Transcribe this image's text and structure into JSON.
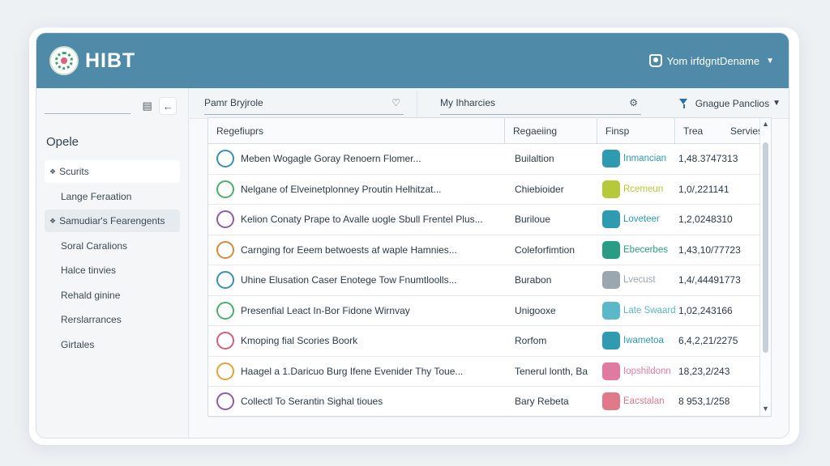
{
  "app": {
    "brand": "HIBT",
    "user": "Yom irfdgntDename"
  },
  "sidebar": {
    "title": "Opele",
    "items": [
      {
        "label": "Scurits",
        "selected": true
      },
      {
        "label": "Lange Feraation",
        "selected": false
      },
      {
        "label": "Samudiar's Fearengents",
        "selected": true
      },
      {
        "label": "Soral Caralions",
        "selected": false
      },
      {
        "label": "Halce tinvies",
        "selected": false
      },
      {
        "label": "Rehald ginine",
        "selected": false
      },
      {
        "label": "Rerslarrances",
        "selected": false
      },
      {
        "label": "Girtales",
        "selected": false
      }
    ]
  },
  "toolbar": {
    "field1": "Pamr Bryjrole",
    "field2": "My Ihharcies",
    "filter": "Gnague Panclios"
  },
  "table": {
    "columns": [
      "Regefiuprs",
      "Regaeiing",
      "Finsp",
      "Trea",
      "Servies"
    ],
    "rows": [
      {
        "title": "Meben Wogagle Goray Renoern Flomer...",
        "region": "Builaltion",
        "group": "Inmancian",
        "value": "1,48.3747313",
        "avatar": "#3b8fb0",
        "gcolor": "#2f9bb0"
      },
      {
        "title": "Nelgane of Elveinetplonney Proutin Helhitzat...",
        "region": "Chiebioider",
        "group": "Rcemeun",
        "value": "1,0/,221141",
        "avatar": "#4caf6a",
        "gcolor": "#b6c93a"
      },
      {
        "title": "Kelion Conaty Prape to Avalle uogle Sbull Frentel Plus...",
        "region": "Buriloue",
        "group": "Loveteer",
        "value": "1,2,0248310",
        "avatar": "#8f5aa8",
        "gcolor": "#2f9bb0"
      },
      {
        "title": "Carnging for Eeem betwoests af waple Hamnies...",
        "region": "Coleforfimtion",
        "group": "Ebecerbes",
        "value": "1,43,10/77723",
        "avatar": "#d38a3a",
        "gcolor": "#2a9c86"
      },
      {
        "title": "Uhine Elusation Caser Enotege Tow Fnumtloolls...",
        "region": "Burabon",
        "group": "Lvecust",
        "value": "1,4/,44491773",
        "avatar": "#3b8fb0",
        "gcolor": "#9aa6b0"
      },
      {
        "title": "Presenfial Leact In-Bor Fidone Wirnvay",
        "region": "Unigooxe",
        "group": "Late Swaard",
        "value": "1,02,243166",
        "avatar": "#4caf6a",
        "gcolor": "#5cb8c8"
      },
      {
        "title": "Kmoping fial Scories Boork",
        "region": "Rorfom",
        "group": "Iwametoa",
        "value": "6,4,2,21/2275",
        "avatar": "#d35f7a",
        "gcolor": "#2f9bb0"
      },
      {
        "title": "Haagel a 1.Daricuo Burg Ifene Evenider Thy Toue...",
        "region": "Tenerul lonth, Ba",
        "group": "Iopshildonn",
        "value": "18,23,2/243",
        "avatar": "#e0a53a",
        "gcolor": "#e07aa0"
      },
      {
        "title": "Collectl To Serantin Sighal tioues",
        "region": "Bary Rebeta",
        "group": "Eacstalan",
        "value": "8 953,1/258",
        "avatar": "#8f5aa8",
        "gcolor": "#e07a8a"
      }
    ]
  }
}
